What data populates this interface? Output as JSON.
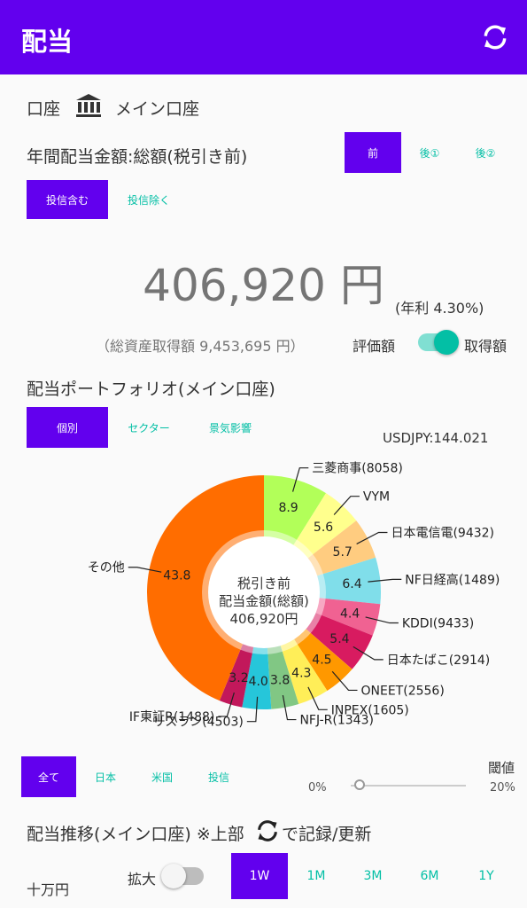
{
  "app": {
    "title": "配当"
  },
  "account": {
    "label": "口座",
    "name": "メイン口座"
  },
  "annual": {
    "title": "年間配当金額:総額(税引き前)",
    "tax_buttons": [
      "前",
      "後①",
      "後②"
    ],
    "fund_buttons": [
      "投信含む",
      "投信除く"
    ],
    "amount": "406,920 円",
    "yield": "(年利 4.30%)",
    "total_cost": "（総資産取得額 9,453,695 円）",
    "toggle_left": "評価額",
    "toggle_right": "取得額"
  },
  "portfolio": {
    "title": "配当ポートフォリオ(メイン口座)",
    "view_buttons": [
      "個別",
      "セクター",
      "景気影響"
    ],
    "fx": "USDJPY:144.021",
    "center_line1": "税引き前",
    "center_line2": "配当金額(総額)",
    "center_line3": "406,920円"
  },
  "chart_data": {
    "type": "pie",
    "categories": [
      "三菱商事(8058)",
      "VYM",
      "日本電信電(9432)",
      "NF日経高(1489)",
      "KDDI(9433)",
      "日本たばこ(2914)",
      "ONEET(2556)",
      "INPEX(1605)",
      "NFJ-R(1343)",
      "リスラン(4503)",
      "IF東証R(1488)",
      "その他"
    ],
    "values": [
      8.9,
      5.6,
      5.7,
      6.4,
      4.4,
      5.4,
      4.5,
      4.3,
      3.8,
      4.0,
      3.2,
      43.8
    ],
    "value_labels": [
      "8.9",
      "5.6",
      "5.7",
      "6.4",
      "4.4",
      "5.4",
      "4.5",
      "4.3",
      "3.8",
      "4.0",
      "3.2",
      "43.8"
    ],
    "colors": [
      "#b2ff59",
      "#ffff8d",
      "#ffcc80",
      "#80deea",
      "#f06292",
      "#d81b60",
      "#ff9800",
      "#ffee58",
      "#81c784",
      "#26c6da",
      "#c2185b",
      "#ff6d00"
    ]
  },
  "filter": {
    "buttons": [
      "全て",
      "日本",
      "米国",
      "投信"
    ],
    "threshold_label": "閾値",
    "threshold_min": "0%",
    "threshold_max": "20%",
    "threshold_value": 0.08
  },
  "trend": {
    "title_pre": "配当推移(メイン口座) ※上部",
    "title_post": "で記録/更新",
    "unit": "十万円",
    "zoom_label": "拡大",
    "ranges": [
      "1W",
      "1M",
      "3M",
      "6M",
      "1Y"
    ]
  },
  "colors": {
    "primary": "#6200ee",
    "accent": "#03bfa5"
  }
}
